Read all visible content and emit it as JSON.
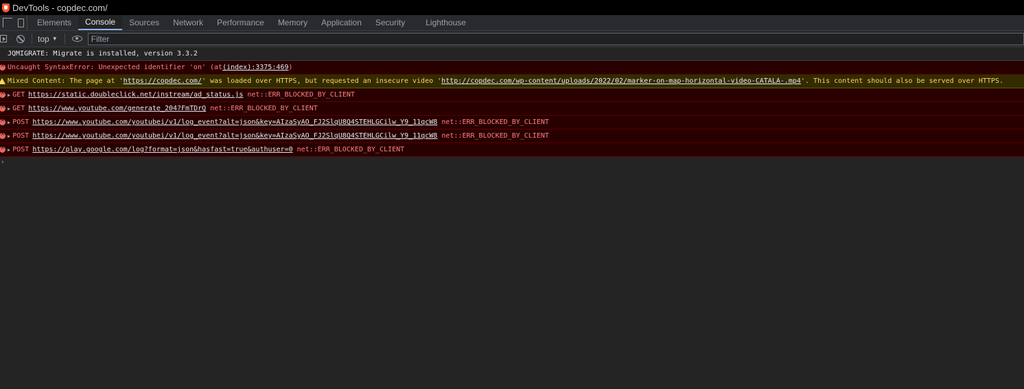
{
  "window": {
    "title": "DevTools - copdec.com/"
  },
  "tabs": [
    "Elements",
    "Console",
    "Sources",
    "Network",
    "Performance",
    "Memory",
    "Application",
    "Security",
    "Lighthouse"
  ],
  "toolbar": {
    "context": "top",
    "filter_placeholder": "Filter"
  },
  "console": {
    "info_message": "JQMIGRATE: Migrate is installed, version 3.3.2",
    "syntax_error": {
      "text": "Uncaught SyntaxError: Unexpected identifier 'on' (at ",
      "link": "(index):3375:469",
      "suffix": ")"
    },
    "mixed": {
      "p1": "Mixed Content: The page at '",
      "link1": "https://copdec.com/",
      "p2": "' was loaded over HTTPS, but requested an insecure video '",
      "link2": "http://copdec.com/wp-content/uploads/2022/02/marker-on-map-horizontal-video-CATALA-.mp4",
      "p3": "'. This content should also be served over HTTPS."
    },
    "network_errors": [
      {
        "method": "GET",
        "url": "https://static.doubleclick.net/instream/ad_status.js",
        "error": "net::ERR_BLOCKED_BY_CLIENT"
      },
      {
        "method": "GET",
        "url": "https://www.youtube.com/generate_204?FmTDrQ",
        "error": "net::ERR_BLOCKED_BY_CLIENT"
      },
      {
        "method": "POST",
        "url": "https://www.youtube.com/youtubei/v1/log_event?alt=json&key=AIzaSyAO_FJ2SlqU8Q4STEHLGCilw_Y9_11qcW8",
        "error": "net::ERR_BLOCKED_BY_CLIENT"
      },
      {
        "method": "POST",
        "url": "https://www.youtube.com/youtubei/v1/log_event?alt=json&key=AIzaSyAO_FJ2SlqU8Q4STEHLGCilw_Y9_11qcW8",
        "error": "net::ERR_BLOCKED_BY_CLIENT"
      },
      {
        "method": "POST",
        "url": "https://play.google.com/log?format=json&hasfast=true&authuser=0",
        "error": "net::ERR_BLOCKED_BY_CLIENT"
      }
    ]
  },
  "colors": {
    "error_bg": "#290000",
    "error_text": "#ff8080",
    "warn_bg": "#332b00",
    "warn_text": "#fdd663",
    "active_tab": "#8ab4f8"
  }
}
